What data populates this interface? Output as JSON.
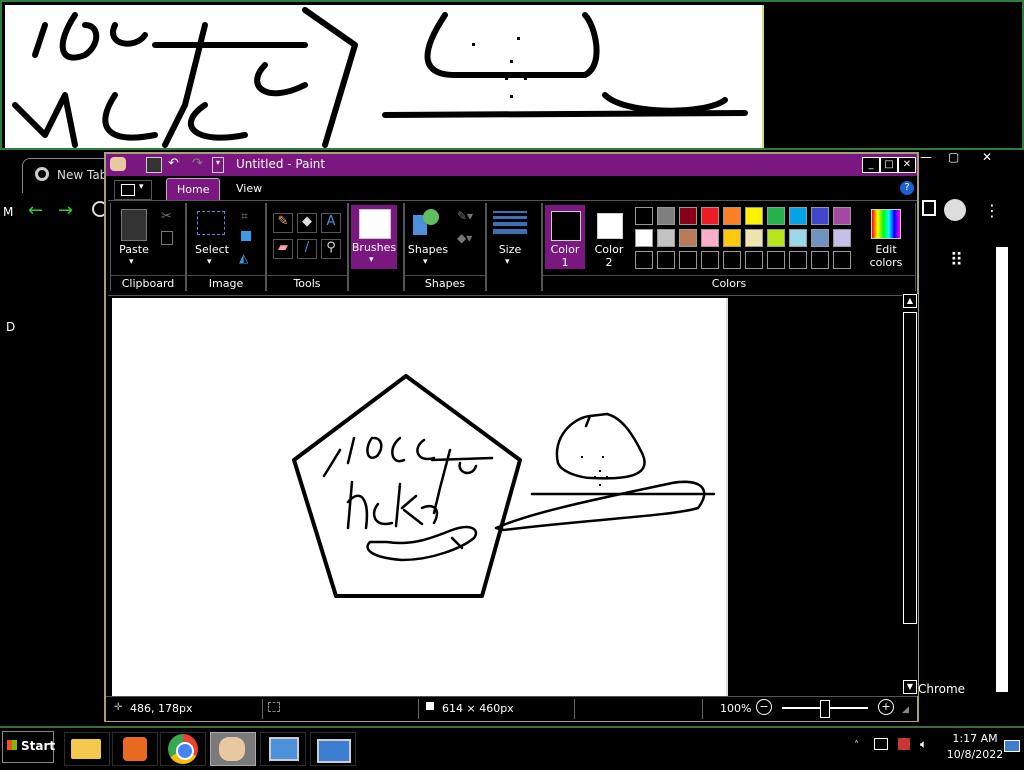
{
  "magnifier": {
    "label": "Magnifier view"
  },
  "chrome": {
    "tab_label": "New Tab",
    "side_text_chrome": "Chrome",
    "letters": [
      "M",
      "D"
    ]
  },
  "paint": {
    "title": "Untitled - Paint",
    "tabs": [
      "Home",
      "View"
    ],
    "groups": {
      "clipboard": {
        "label": "Clipboard",
        "paste": "Paste"
      },
      "image": {
        "label": "Image",
        "select": "Select"
      },
      "tools": {
        "label": "Tools"
      },
      "brushes": {
        "label": "Brushes"
      },
      "shapes": {
        "label": "Shapes",
        "shapes_btn": "Shapes"
      },
      "size": {
        "label": "Size"
      },
      "colors": {
        "label": "Colors",
        "color1": "Color",
        "color1_num": "1",
        "color2": "Color",
        "color2_num": "2",
        "edit": "Edit",
        "edit2": "colors",
        "palette_row1": [
          "#000000",
          "#7f7f7f",
          "#880015",
          "#ed1c24",
          "#ff7f27",
          "#fff200",
          "#22b14c",
          "#00a2e8",
          "#3f48cc",
          "#a349a4"
        ],
        "palette_row2": [
          "#ffffff",
          "#c3c3c3",
          "#b97a57",
          "#ffaec9",
          "#ffc90e",
          "#efe4b0",
          "#b5e61d",
          "#99d9ea",
          "#7092be",
          "#c8bfe7"
        ]
      }
    },
    "status": {
      "cursor_pos": "486, 178px",
      "canvas_size": "614 × 460px",
      "zoom": "100%"
    }
  },
  "taskbar": {
    "start": "Start",
    "time": "1:17 AM",
    "date": "10/8/2022"
  }
}
